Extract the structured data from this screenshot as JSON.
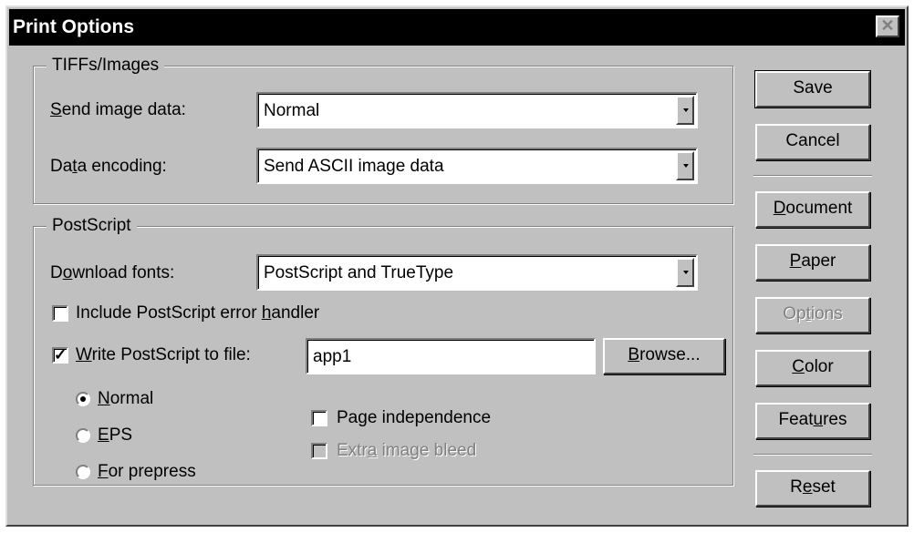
{
  "dialog": {
    "title": "Print Options",
    "close_glyph": "✕"
  },
  "tiffs_group": {
    "legend": "TIFFs/Images",
    "send_image_data": {
      "label": "Send image data:",
      "value": "Normal"
    },
    "data_encoding": {
      "label": "Data encoding:",
      "value": "Send ASCII image data"
    }
  },
  "postscript_group": {
    "legend": "PostScript",
    "download_fonts": {
      "label": "Download fonts:",
      "value": "PostScript and TrueType"
    },
    "include_error_handler": {
      "label": "Include PostScript error handler",
      "checked": false
    },
    "write_to_file": {
      "label": "Write PostScript to file:",
      "checked": true,
      "check_glyph": "✓",
      "value": "app1"
    },
    "browse_label": "Browse...",
    "radios": [
      {
        "label": "Normal",
        "selected": true
      },
      {
        "label": "EPS",
        "selected": false
      },
      {
        "label": "For prepress",
        "selected": false
      }
    ],
    "page_independence": {
      "label": "Page independence",
      "checked": false
    },
    "extra_image_bleed": {
      "label": "Extra image bleed",
      "checked": false,
      "disabled": true
    }
  },
  "buttons": {
    "save": "Save",
    "cancel": "Cancel",
    "document": "Document",
    "paper": "Paper",
    "options": "Options",
    "color": "Color",
    "features": "Features",
    "reset": "Reset"
  }
}
